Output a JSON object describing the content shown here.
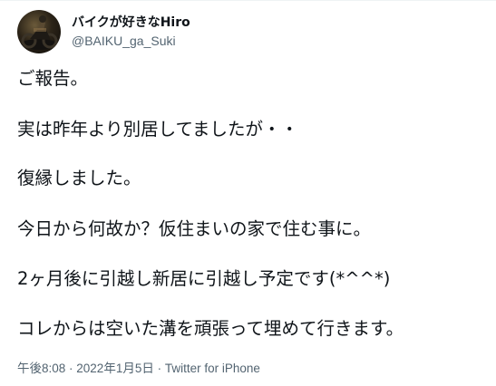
{
  "author": {
    "display_name": "バイクが好きなHiro",
    "handle": "@BAIKU_ga_Suki"
  },
  "tweet": {
    "lines": [
      "ご報告。",
      "実は昨年より別居してましたが・・",
      "復縁しました。",
      "今日から何故か？仮住まいの家で住む事に。",
      "2ヶ月後に引越し新居に引越し予定です(*^^*)",
      "コレからは空いた溝を頑張って埋めて行きます。"
    ]
  },
  "meta": {
    "time": "午後8:08",
    "separator1": " · ",
    "date": "2022年1月5日",
    "separator2": " · ",
    "source": "Twitter for iPhone"
  },
  "colors": {
    "text": "#0f1419",
    "secondary": "#536471",
    "border": "#eff3f4"
  }
}
